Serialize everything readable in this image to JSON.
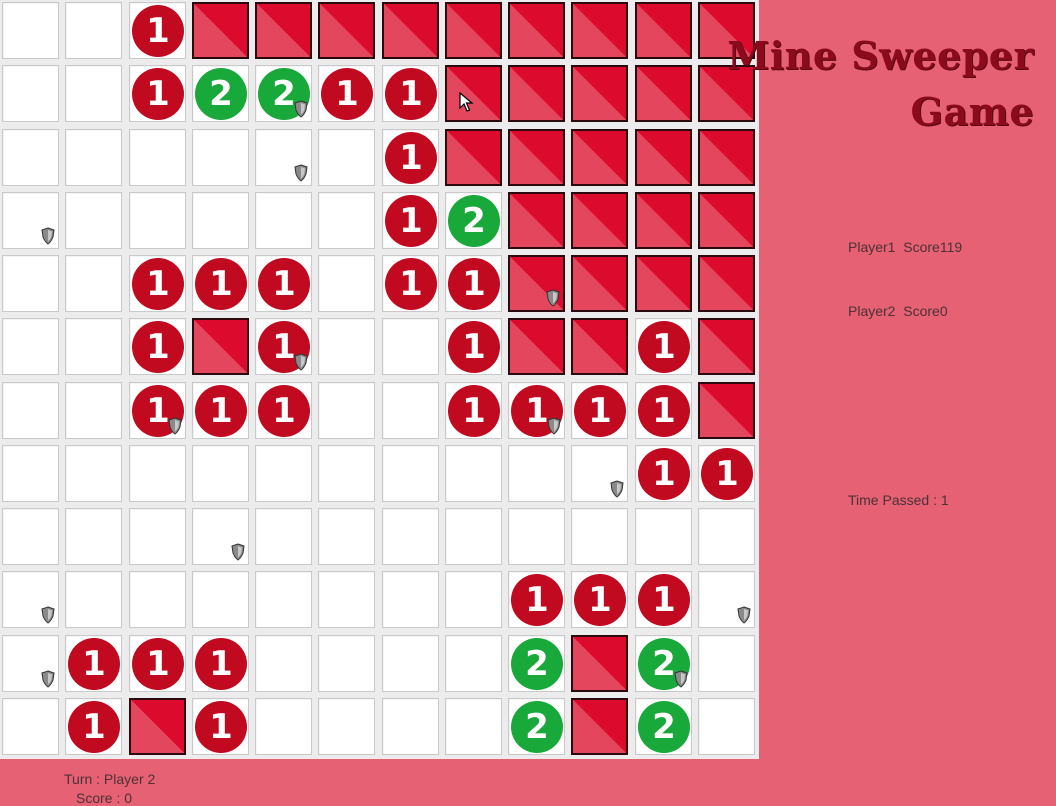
{
  "title_line1": "Mine Sweeper",
  "title_line2": "Game",
  "player1": "Player1  Score119",
  "player2": "Player2  Score0",
  "time_passed": "Time Passed : 1",
  "turn": "Turn : Player 2",
  "score": "Score : 0",
  "icons": {
    "flag_marker": "shield-icon",
    "pointer": "mouse-cursor-icon"
  },
  "colors": {
    "background": "#e66173",
    "hidden_tile": "#dc0a2c",
    "number_one": "#c1091f",
    "number_two": "#19a83a",
    "title": "#8b0b1c"
  },
  "grid": {
    "rows": 12,
    "cols": 12,
    "legend": "H = hidden tile, . = revealed empty, digits = revealed number",
    "cells": [
      "..1HHHHHHHHH",
      "..12211HHHHH",
      "......1HHHHH",
      "......12HHHH",
      "..111.11HHHH",
      "..1H1..1HH1H",
      "..111..1111H",
      "..........11",
      "............",
      "........111.",
      ".111....2H2.",
      ".1H1....2H2."
    ],
    "shields": [
      [
        1,
        4
      ],
      [
        2,
        4
      ],
      [
        3,
        0
      ],
      [
        4,
        8
      ],
      [
        5,
        4
      ],
      [
        6,
        2
      ],
      [
        6,
        8
      ],
      [
        7,
        9
      ],
      [
        8,
        3
      ],
      [
        9,
        0
      ],
      [
        9,
        11
      ],
      [
        10,
        0
      ],
      [
        10,
        10
      ]
    ]
  }
}
